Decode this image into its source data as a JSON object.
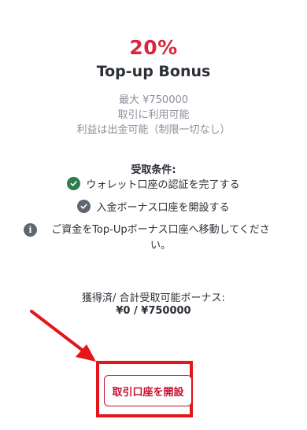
{
  "bonus": {
    "percent": "20%",
    "title": "Top-up Bonus",
    "info": [
      "最大 ¥750000",
      "取引に利用可能",
      "利益は出金可能（制限一切なし）"
    ]
  },
  "conditions": {
    "heading": "受取条件:",
    "items": [
      {
        "text": "ウォレット口座の認証を完了する",
        "status": "completed",
        "color": "#2e7d4a"
      },
      {
        "text": "入金ボーナス口座を開設する",
        "status": "pending",
        "color": "#5f6670"
      }
    ],
    "note": "ご資金をTop-Upボーナス口座へ移動してください。"
  },
  "earned": {
    "label": "獲得済/ 合計受取可能ボーナス:",
    "value": "¥0 / ¥750000"
  },
  "actions": {
    "open_account_label": "取引口座を開設"
  },
  "colors": {
    "accent": "#d7263d",
    "annotation_red": "#e3161b",
    "muted_text": "#8a8f98"
  },
  "icons": {
    "check_completed": "check-circle-icon",
    "check_pending": "check-circle-icon",
    "info": "info-icon",
    "annotation_arrow": "arrow-icon"
  }
}
